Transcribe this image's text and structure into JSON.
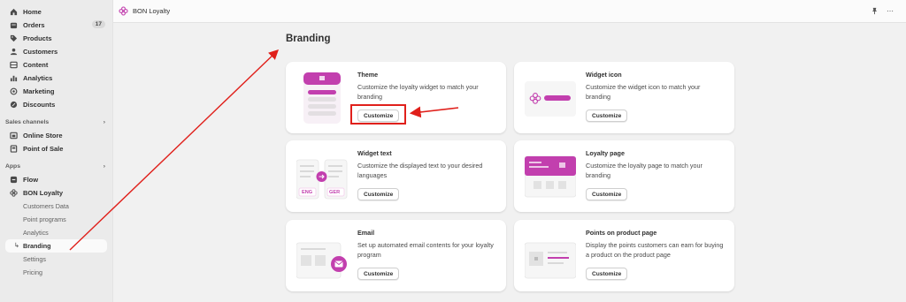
{
  "sidebar": {
    "main_items": [
      {
        "label": "Home",
        "icon": "home-icon"
      },
      {
        "label": "Orders",
        "icon": "orders-icon",
        "badge": "17"
      },
      {
        "label": "Products",
        "icon": "tag-icon"
      },
      {
        "label": "Customers",
        "icon": "person-icon"
      },
      {
        "label": "Content",
        "icon": "content-icon"
      },
      {
        "label": "Analytics",
        "icon": "chart-icon"
      },
      {
        "label": "Marketing",
        "icon": "target-icon"
      },
      {
        "label": "Discounts",
        "icon": "discount-icon"
      }
    ],
    "sales_channels_label": "Sales channels",
    "sales_channels": [
      {
        "label": "Online Store",
        "icon": "store-icon"
      },
      {
        "label": "Point of Sale",
        "icon": "pos-icon"
      }
    ],
    "apps_label": "Apps",
    "apps": [
      {
        "label": "Flow",
        "icon": "flow-icon"
      },
      {
        "label": "BON Loyalty",
        "icon": "flower-icon"
      }
    ],
    "app_subitems": [
      "Customers Data",
      "Point programs",
      "Analytics",
      "Branding",
      "Settings",
      "Pricing"
    ],
    "active_subitem": "Branding"
  },
  "topbar": {
    "app_name": "BON Loyalty"
  },
  "page": {
    "title": "Branding",
    "cards": [
      {
        "title": "Theme",
        "description": "Customize the loyalty widget to match your branding",
        "button": "Customize"
      },
      {
        "title": "Widget icon",
        "description": "Customize the widget icon to match your branding",
        "button": "Customize"
      },
      {
        "title": "Widget text",
        "description": "Customize the displayed text to your desired languages",
        "button": "Customize",
        "illus_labels": [
          "ENG",
          "GER"
        ]
      },
      {
        "title": "Loyalty page",
        "description": "Customize the loyalty page to match your branding",
        "button": "Customize"
      },
      {
        "title": "Email",
        "description": "Set up automated email contents for your loyalty program",
        "button": "Customize"
      },
      {
        "title": "Points on product page",
        "description": "Display the points customers can earn for buying a product on the product page",
        "button": "Customize"
      }
    ]
  },
  "colors": {
    "accent": "#c23fae",
    "accent_light": "#f4d6ee",
    "annotation": "#e0201b"
  }
}
